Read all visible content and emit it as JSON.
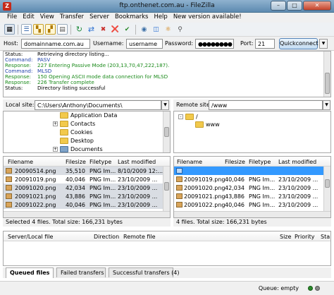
{
  "window": {
    "title": "ftp.onthenet.com.au - FileZilla",
    "app_icon": "Z"
  },
  "menu": [
    "File",
    "Edit",
    "View",
    "Transfer",
    "Server",
    "Bookmarks",
    "Help",
    "New version available!"
  ],
  "toolbar_icons": [
    "site-manager-icon",
    "toggle-log-icon",
    "toggle-local-tree-icon",
    "toggle-remote-tree-icon",
    "toggle-queue-icon",
    "refresh-icon",
    "process-queue-icon",
    "cancel-icon",
    "disconnect-icon",
    "reconnect-icon",
    "view-hidden-icon",
    "compare-icon",
    "sync-browse-icon",
    "find-icon"
  ],
  "quickconnect": {
    "host_label": "Host:",
    "host_value": "domainname.com.au",
    "user_label": "Username:",
    "user_value": "username",
    "pass_label": "Password:",
    "pass_value": "●●●●●●●●",
    "port_label": "Port:",
    "port_value": "21",
    "button": "Quickconnect"
  },
  "log": [
    {
      "label": "Status:",
      "message": "Retrieving directory listing...",
      "color": "#000000"
    },
    {
      "label": "Command:",
      "message": "PASV",
      "color": "#1d3fa8"
    },
    {
      "label": "Response:",
      "message": "227 Entering Passive Mode (203,13,70,47,222,187).",
      "color": "#1a8a1a"
    },
    {
      "label": "Command:",
      "message": "MLSD",
      "color": "#1d3fa8"
    },
    {
      "label": "Response:",
      "message": "150 Opening ASCII mode data connection for MLSD",
      "color": "#1a8a1a"
    },
    {
      "label": "Response:",
      "message": "226 Transfer complete",
      "color": "#1a8a1a"
    },
    {
      "label": "Status:",
      "message": "Directory listing successful",
      "color": "#000000"
    }
  ],
  "local": {
    "site_label": "Local site:",
    "site_path": "C:\\Users\\Anthony\\Documents\\",
    "tree": [
      {
        "label": "Application Data",
        "expander": ""
      },
      {
        "label": "Contacts",
        "expander": "+"
      },
      {
        "label": "Cookies",
        "expander": ""
      },
      {
        "label": "Desktop",
        "expander": ""
      },
      {
        "label": "Documents",
        "expander": "+"
      }
    ],
    "columns": [
      "Filename",
      "Filesize",
      "Filetype",
      "Last modified"
    ],
    "files": [
      {
        "name": "20090514.png",
        "size": "35,510",
        "type": "PNG Im...",
        "modified": "8/10/2009 12:...",
        "selected": true
      },
      {
        "name": "20091019.png",
        "size": "40,046",
        "type": "PNG Im...",
        "modified": "23/10/2009 ...",
        "selected": false
      },
      {
        "name": "20091020.png",
        "size": "42,034",
        "type": "PNG Im...",
        "modified": "23/10/2009 ...",
        "selected": true
      },
      {
        "name": "20091021.png",
        "size": "43,886",
        "type": "PNG Im...",
        "modified": "23/10/2009 ...",
        "selected": true
      },
      {
        "name": "20091022.png",
        "size": "40,046",
        "type": "PNG Im...",
        "modified": "23/10/2009 ...",
        "selected": true
      }
    ],
    "status": "Selected 4 files. Total size: 166,231 bytes"
  },
  "remote": {
    "site_label": "Remote site:",
    "site_path": "/www",
    "tree": [
      {
        "label": "/",
        "expander": "-"
      },
      {
        "label": "www",
        "expander": ""
      }
    ],
    "columns": [
      "Filename",
      "Filesize",
      "Filetype",
      "Last modified"
    ],
    "files": [
      {
        "name": "",
        "size": "",
        "type": "",
        "modified": "",
        "selected": false,
        "highlight": true
      },
      {
        "name": "20091019.png",
        "size": "40,046",
        "type": "PNG Im...",
        "modified": "23/10/2009 ...",
        "selected": false
      },
      {
        "name": "20091020.png",
        "size": "42,034",
        "type": "PNG Im...",
        "modified": "23/10/2009 ...",
        "selected": false
      },
      {
        "name": "20091021.png",
        "size": "43,886",
        "type": "PNG Im...",
        "modified": "23/10/2009 ...",
        "selected": false
      },
      {
        "name": "20091022.png",
        "size": "40,046",
        "type": "PNG Im...",
        "modified": "23/10/2009 ...",
        "selected": false
      }
    ],
    "status": "4 files. Total size: 166,231 bytes"
  },
  "queue": {
    "columns": [
      "Server/Local file",
      "Direction",
      "Remote file",
      "Size",
      "Priority",
      "Sta"
    ],
    "tabs": [
      "Queued files",
      "Failed transfers",
      "Successful transfers (4)"
    ],
    "active_tab": 0,
    "status": "Queue: empty"
  },
  "colors": {
    "selected_row": "#d9dde3",
    "highlight_row": "#3399ff",
    "title_bar": "#6c93b8"
  }
}
